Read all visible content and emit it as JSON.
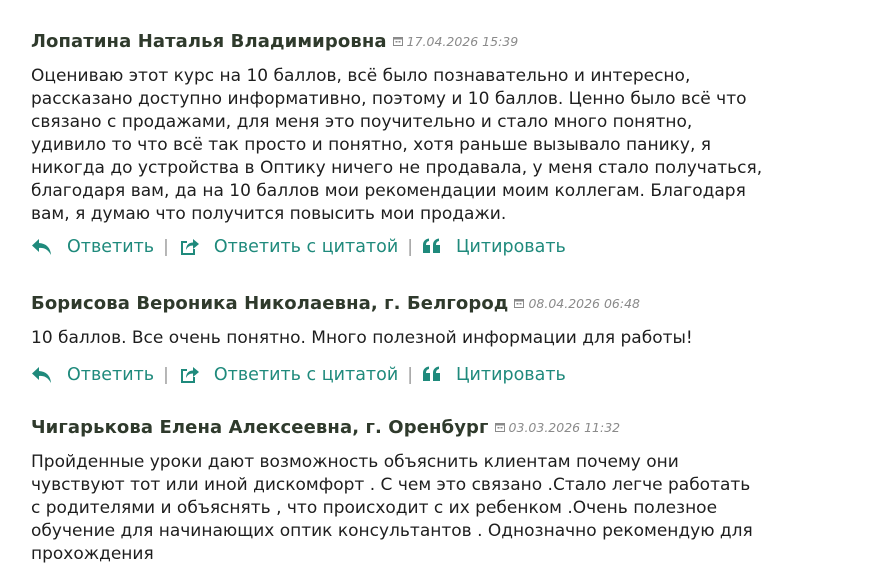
{
  "comments": [
    {
      "author": "Лопатина Наталья Владимировна",
      "date": "17.04.2026 15:39",
      "lines": [
        "Оцениваю этот курс на 10 баллов, всё было познавательно и интересно,",
        "рассказано доступно информативно, поэтому и 10 баллов. Ценно было всё что",
        "связано с продажами, для меня это поучительно и стало много понятно,",
        "удивило то что всё так просто и понятно, хотя раньше вызывало панику, я",
        "никогда до устройства в Оптику ничего не продавала, у меня стало получаться,",
        "благодаря вам, да на 10 баллов мои рекомендации моим коллегам. Благодаря",
        "вам, я думаю что получится повысить мои продажи."
      ]
    },
    {
      "author": "Борисова Вероника Николаевна, г. Белгород",
      "date": "08.04.2026 06:48",
      "lines": [
        "10 баллов. Все очень понятно. Много полезной информации для работы!"
      ]
    },
    {
      "author": "Чигарькова Елена Алексеевна, г. Оренбург",
      "date": "03.03.2026 11:32",
      "lines": [
        "Пройденные уроки дают возможность объяснить клиентам почему они",
        "чувствуют тот или иной дискомфорт . С чем это связано .Стало легче работать",
        "с родителями и объяснять , что происходит с их ребенком .Очень полезное",
        "обучение для начинающих оптик консультантов . Однозначно рекомендую для",
        "прохождения"
      ]
    }
  ],
  "actions": {
    "reply": "Ответить",
    "reply_quote": "Ответить с цитатой",
    "quote": "Цитировать",
    "separator": "|"
  },
  "icons": {
    "reply": "reply-arrow-icon",
    "reply_quote": "share-box-icon",
    "quote": "quote-icon",
    "date": "calendar-icon"
  },
  "colors": {
    "author": "#2f3a2c",
    "text": "#1e1e1e",
    "date": "#8a8a8a",
    "action": "#1f8a7c",
    "separator": "#9a9a9a"
  }
}
